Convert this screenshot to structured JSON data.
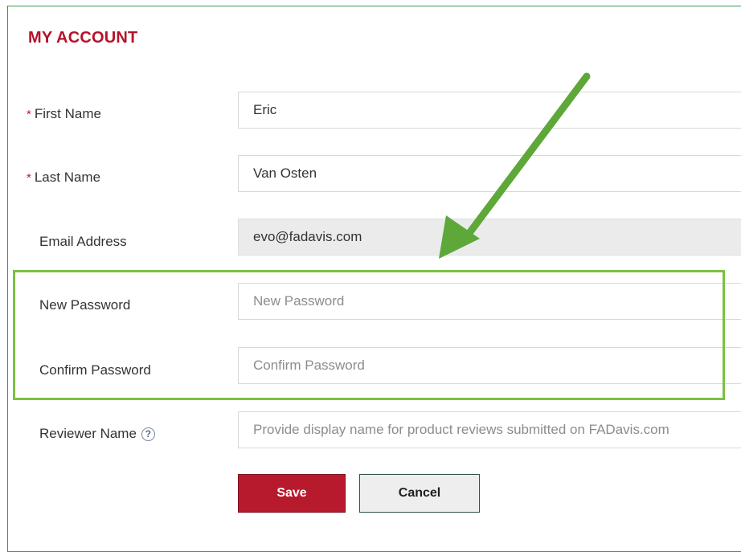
{
  "page": {
    "title": "MY ACCOUNT"
  },
  "form": {
    "required_mark": "*",
    "first_name": {
      "label": "First Name",
      "value": "Eric"
    },
    "last_name": {
      "label": "Last Name",
      "value": "Van Osten"
    },
    "email": {
      "label": "Email Address",
      "value": "evo@fadavis.com"
    },
    "new_password": {
      "label": "New Password",
      "placeholder": "New Password"
    },
    "confirm_password": {
      "label": "Confirm Password",
      "placeholder": "Confirm Password"
    },
    "reviewer_name": {
      "label": "Reviewer Name",
      "help_icon": "?",
      "placeholder": "Provide display name for product reviews submitted on FADavis.com"
    }
  },
  "buttons": {
    "save_label": "Save",
    "cancel_label": "Cancel"
  },
  "annotation": {
    "arrow_color": "#5ea83a",
    "highlight_color": "#7cc142"
  },
  "colors": {
    "title": "#b5122a",
    "save_button": "#b71a2c",
    "frame_border": "#3a9a4a"
  }
}
